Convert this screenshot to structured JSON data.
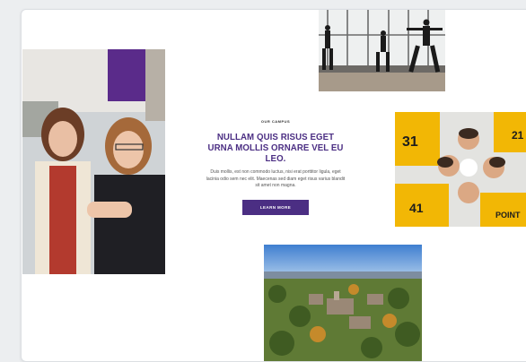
{
  "feature": {
    "eyebrow": "OUR CAMPUS",
    "heading": "NULLAM QUIS RISUS EGET URNA MOLLIS ORNARE VEL EU LEO.",
    "body": "Duis mollis, est non commodo luctus, nisi erat porttitor ligula, eget lacinia odio sem nec elit. Maecenas sed diam eget risus varius blandit sit amet non magna.",
    "cta_label": "LEARN MORE"
  },
  "colors": {
    "brand_purple": "#4b2e83",
    "athlete_gold": "#f2b705"
  },
  "images": {
    "students": "two-students-smiling-photo",
    "dance": "dance-studio-photo",
    "athletes": "athletes-huddle-photo",
    "campus": "campus-aerial-photo"
  }
}
